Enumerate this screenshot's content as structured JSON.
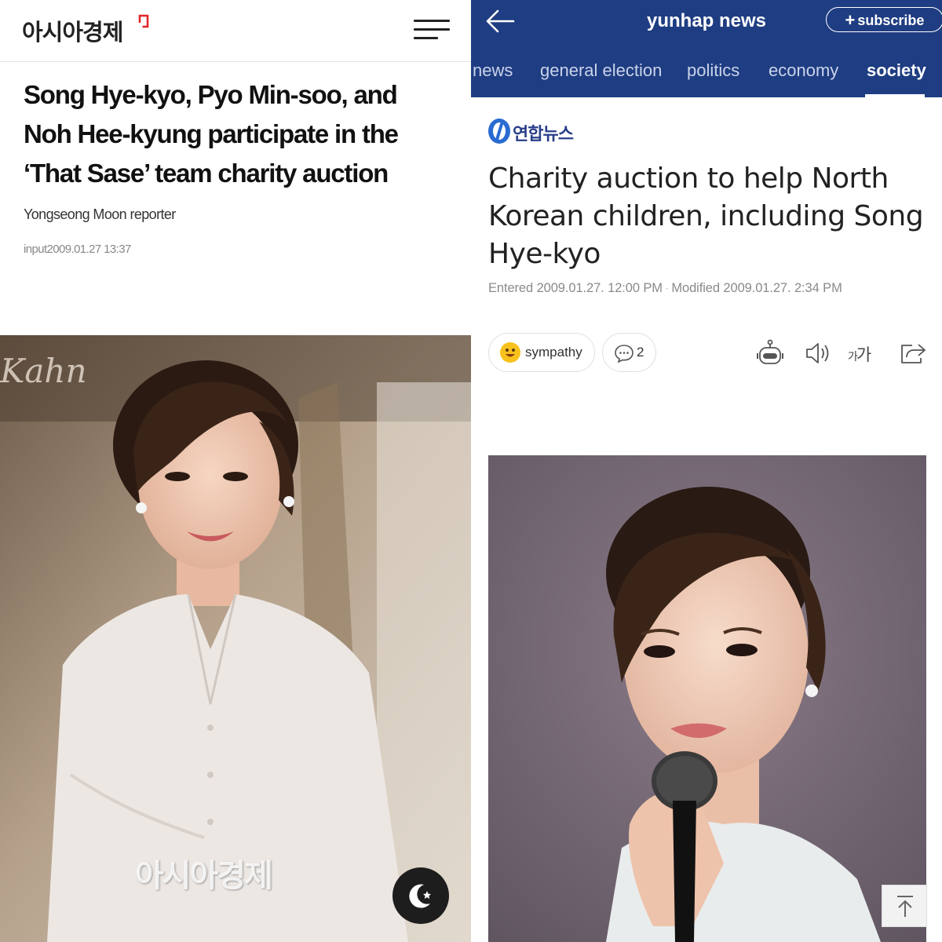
{
  "left_article": {
    "logo_text": "아시아경제",
    "title_lines": [
      "Song Hye-kyo, Pyo Min-soo, and",
      "Noh Hee-kyung participate in the",
      "‘That Sase’ team charity auction"
    ],
    "reporter": "Yongseong Moon reporter",
    "date": "input2009.01.27 13:37",
    "photo_watermark": "아시아경제",
    "icons": [
      "menu-icon",
      "moon-star-icon"
    ],
    "colors": {
      "logo_accent": "#e3262b",
      "title": "#111111"
    }
  },
  "right_article": {
    "header_title": "yunhap news",
    "subscribe_label": "subscribe",
    "tabs": [
      {
        "label": "news"
      },
      {
        "label": "general election"
      },
      {
        "label": "politics"
      },
      {
        "label": "economy"
      },
      {
        "label": "society"
      }
    ],
    "active_tab": "society",
    "brand_name": "연합뉴스",
    "headline_lines": [
      "Charity auction to help North",
      "Korean children, including Song",
      "Hye-kyo"
    ],
    "entered_label": "Entered",
    "entered_date": "2009.01.27. 12:00 PM",
    "modified_label": "Modified",
    "modified_date": "2009.01.27. 2:34 PM",
    "sympathy_label": "sympathy",
    "comment_count": "2",
    "font_size_label_small": "가",
    "font_size_label_big": "가",
    "icons": [
      "back-arrow-icon",
      "plus-icon",
      "smiley-icon",
      "comment-icon",
      "robot-icon",
      "speaker-icon",
      "share-icon",
      "scroll-top-icon"
    ],
    "colors": {
      "header_bg": "#1f3d82",
      "brand": "#2a3f8a"
    }
  }
}
